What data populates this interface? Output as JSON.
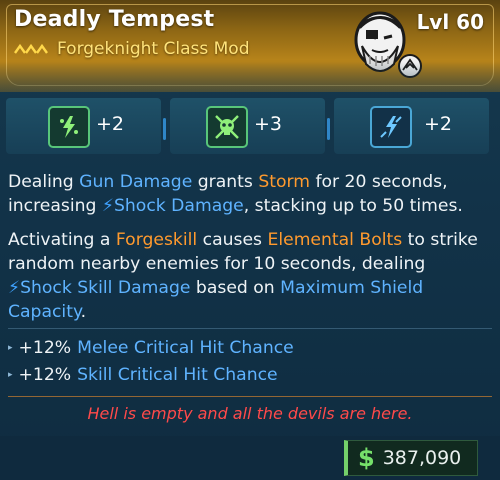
{
  "item": {
    "name": "Deadly Tempest",
    "type_label": "Forgeknight Class Mod",
    "level": "Lvl 60",
    "portrait_icon": "forgeknight-portrait-icon",
    "rarity_icon": "legendary-chevrons-icon"
  },
  "perks": [
    {
      "icon": "shock-bolt-skill-icon",
      "value": "+2"
    },
    {
      "icon": "skull-crossed-swords-icon",
      "value": "+3"
    },
    {
      "icon": "lightning-slash-icon",
      "value": "+2"
    }
  ],
  "description": {
    "p1": {
      "t1": "Dealing ",
      "k1": "Gun Damage",
      "t2": " grants ",
      "k2": "Storm",
      "t3": " for 20 seconds, increasing ",
      "k3": "Shock Damage",
      "t4": ", stacking up to 50 times."
    },
    "p2": {
      "t1": "Activating a ",
      "k1": "Forgeskill",
      "t2": " causes ",
      "k2": "Elemental Bolts",
      "t3": " to strike random nearby enemies for 10 seconds, dealing ",
      "k3": "Shock Skill Damage",
      "t4": " based on ",
      "k4": "Maximum Shield Capacity",
      "t5": "."
    }
  },
  "stats": [
    {
      "pct": "+12%",
      "label": "Melee Critical Hit Chance"
    },
    {
      "pct": "+12%",
      "label": "Skill Critical Hit Chance"
    }
  ],
  "flavor_text": "Hell is empty and all the devils are here.",
  "price": {
    "symbol": "$",
    "amount": "387,090"
  },
  "colors": {
    "header_gold": "#b6831a",
    "keyword_blue": "#5fb3ff",
    "keyword_orange": "#ff9a2e",
    "flavor_red": "#ff4a4a",
    "price_green": "#76e06a"
  }
}
